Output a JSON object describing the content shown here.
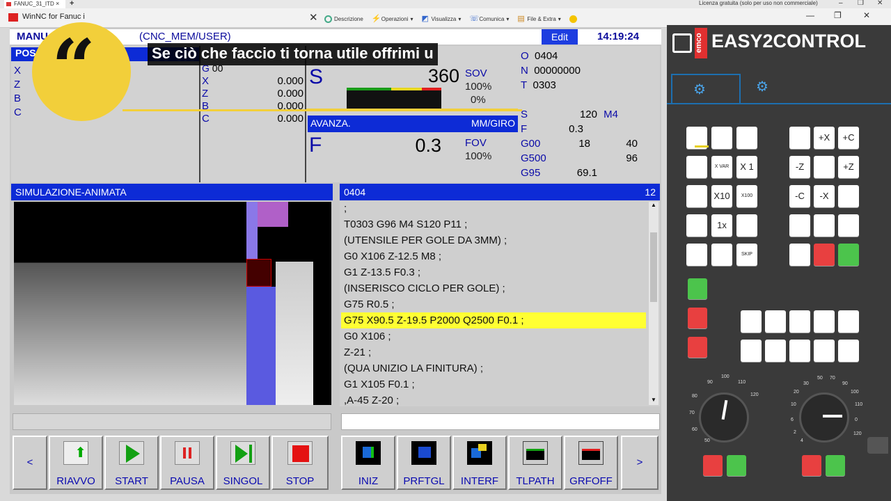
{
  "browser": {
    "tab_title": "FANUC_31_ITD",
    "tab_close": "×",
    "new_tab": "+",
    "license_text": "Licenza gratuita (solo per uso non commerciale)",
    "min": "–",
    "restore": "❐",
    "close": "✕"
  },
  "window": {
    "title": "WinNC for Fanuc i",
    "menu": [
      {
        "label": "Descrizione",
        "icon": "refresh-icon"
      },
      {
        "label": "Operazioni",
        "icon": "bolt-icon"
      },
      {
        "label": "Visualizza",
        "icon": "eye-icon"
      },
      {
        "label": "Comunica",
        "icon": "phone-icon"
      },
      {
        "label": "File & Extra",
        "icon": "folder-icon"
      }
    ],
    "close_x": "✕",
    "min": "—",
    "restore": "❐",
    "close": "✕"
  },
  "cnc": {
    "mode": "MANU",
    "path": "(CNC_MEM/USER)",
    "edit_badge": "Edit",
    "clock": "14:19:24",
    "pos_label": "POS",
    "axes": [
      "X",
      "Z",
      "B",
      "C"
    ],
    "g_label": "G",
    "g_value": "00",
    "axes2": [
      {
        "name": "X",
        "value": "0.000"
      },
      {
        "name": "Z",
        "value": "0.000"
      },
      {
        "name": "B",
        "value": "0.000"
      },
      {
        "name": "C",
        "value": "0.000"
      }
    ],
    "s_label": "S",
    "s_value": "360",
    "sov_label": "SOV",
    "sov_value": "100%",
    "sov_extra": "0%",
    "avanza_label": "AVANZA.",
    "avanza_unit": "MM/GIRO",
    "f_label": "F",
    "f_value": "0.3",
    "fov_label": "FOV",
    "fov_value": "100%",
    "o_label": "O",
    "o_value": "0404",
    "n_label": "N",
    "n_value": "00000000",
    "t_label": "T",
    "t_value": "0303",
    "modal": [
      {
        "k": "S",
        "v": "120",
        "x": "M4"
      },
      {
        "k": "F",
        "v": "0.3",
        "x": ""
      },
      {
        "k": "G00",
        "v": "18",
        "x": "40"
      },
      {
        "k": "G500",
        "v": "",
        "x": "96"
      },
      {
        "k": "G95",
        "v": "69.1",
        "x": ""
      }
    ],
    "sim_title": "SIMULAZIONE-ANIMATA",
    "prog_name": "0404",
    "prog_num": "12",
    "code": [
      ";",
      "T0303 G96 M4 S120 P11 ;",
      "(UTENSILE PER GOLE DA 3MM) ;",
      "G0 X106 Z-12.5 M8 ;",
      "G1 Z-13.5 F0.3 ;",
      "(INSERISCO CICLO PER GOLE) ;",
      "G75 R0.5 ;",
      "G75 X90.5 Z-19.5 P2000 Q2500 F0.1 ;",
      "G0 X106 ;",
      "Z-21 ;",
      "(QUA UNIZIO LA FINITURA) ;",
      "G1 X105 F0.1 ;",
      ",A-45 Z-20 ;"
    ],
    "highlight_index": 7,
    "softkeys_left": [
      "RIAVVO",
      "START",
      "PAUSA",
      "SINGOL",
      "STOP"
    ],
    "softkeys_right": [
      "INIZ",
      "PRFTGL",
      "INTERF",
      "TLPATH",
      "GRFOFF"
    ],
    "prev": "<",
    "next": ">"
  },
  "panel": {
    "brand": "EASY2CONTROL",
    "brand_small": "emco",
    "keys_left": [
      [
        "",
        "",
        ""
      ],
      [
        "",
        "X VAR",
        "X 1"
      ],
      [
        "",
        "X10",
        "X100"
      ],
      [
        "",
        "1x",
        ""
      ],
      [
        "",
        "",
        "SKIP"
      ]
    ],
    "keys_right": [
      [
        "",
        "+X",
        "+C"
      ],
      [
        "-Z",
        "",
        "+Z"
      ],
      [
        "-C",
        "-X",
        ""
      ],
      [
        "",
        "",
        ""
      ],
      [
        "",
        "",
        ""
      ]
    ],
    "dial1_ticks": [
      "90",
      "100",
      "110",
      "120",
      "80",
      "70",
      "60",
      "50"
    ],
    "dial2_ticks": [
      "30",
      "50",
      "70",
      "90",
      "20",
      "100",
      "10",
      "110",
      "6",
      "120",
      "2",
      "0",
      "4"
    ]
  },
  "overlay": {
    "quote_mark": "“",
    "subtitle": "Se ciò che faccio ti torna utile offrimi u"
  }
}
